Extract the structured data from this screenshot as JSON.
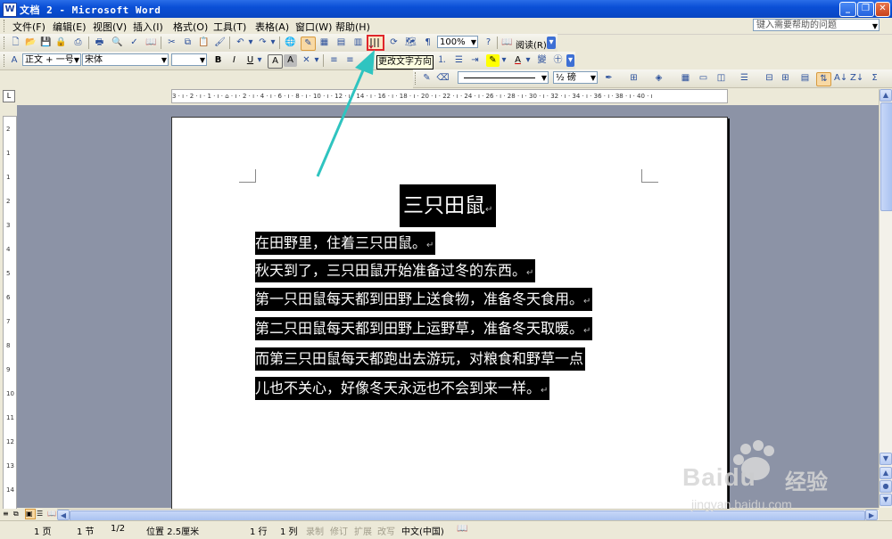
{
  "window": {
    "title": "文档 2 - Microsoft Word",
    "app_icon_letter": "W",
    "controls": {
      "minimize": "_",
      "maximize": "❐",
      "close": "✕"
    }
  },
  "menu": {
    "items": [
      "文件(F)",
      "编辑(E)",
      "视图(V)",
      "插入(I)",
      "格式(O)",
      "工具(T)",
      "表格(A)",
      "窗口(W)",
      "帮助(H)"
    ],
    "help_placeholder": "键入需要帮助的问题"
  },
  "toolbar": {
    "zoom": "100%",
    "read_label": "阅读(R)",
    "style": "正文 + 一号",
    "font": "宋体",
    "tooltip": "更改文字方向",
    "line_weight": "½ 磅"
  },
  "ruler": {
    "horizontal_ticks": "3 · ı · 2 · ı · 1 · ı · ⌂ · ı · 2 · ı · 4 · ı · 6 · ı · 8 · ı · 10 · ı · 12 · ı · 14 · ı · 16 · ı · 18 · ı · 20 · ı · 22 · ı · 24 · ı · 26 · ı · 28 · ı · 30 · ı · 32 · ı · 34 · ı · 36 · ı · 38 · ı · 40 · ı",
    "vertical_ticks": [
      "2",
      "1",
      "1",
      "2",
      "3",
      "4",
      "5",
      "6",
      "7",
      "8",
      "9",
      "10",
      "11",
      "12",
      "13",
      "14"
    ]
  },
  "document": {
    "title": "三只田鼠",
    "lines": [
      "在田野里，住着三只田鼠。",
      "秋天到了，三只田鼠开始准备过冬的东西。",
      "第一只田鼠每天都到田野上送食物，准备冬天食用。",
      "第二只田鼠每天都到田野上运野草，准备冬天取暖。",
      "而第三只田鼠每天都跑出去游玩，对粮食和野草一点",
      "儿也不关心，好像冬天永远也不会到来一样。"
    ],
    "paragraph_mark": "↵"
  },
  "status": {
    "page": "1 页",
    "section": "1 节",
    "page_of": "1/2",
    "position": "位置 2.5厘米",
    "line": "1 行",
    "column": "1 列",
    "record": "录制",
    "revise": "修订",
    "extend": "扩展",
    "overwrite": "改写",
    "language": "中文(中国)"
  },
  "watermark": {
    "brand": "Baidu",
    "brand_cn": "经验",
    "url": "jingyan.baidu.com"
  },
  "colors": {
    "titlebar": "#0a4fd6",
    "highlight_box": "#e0262b",
    "arrow": "#2fc4c0",
    "selection": "#000000",
    "doc_background": "#8c93a6"
  }
}
